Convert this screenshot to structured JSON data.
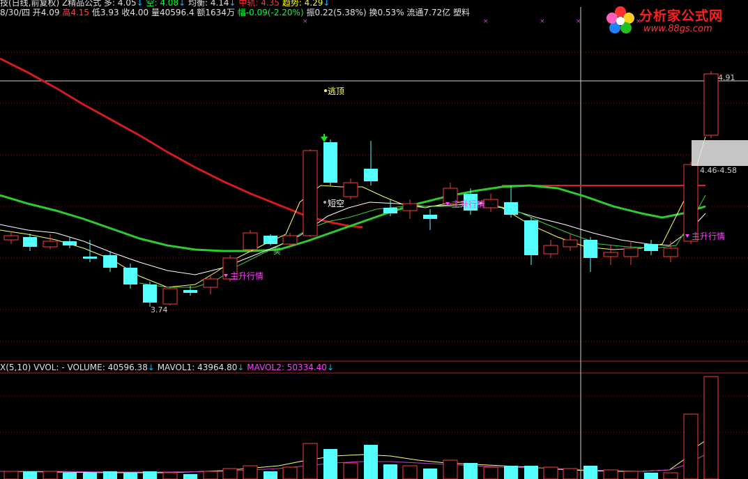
{
  "top_bar": {
    "segments": [
      {
        "text": "技(日线,前复权) Z精品公式  多: 4.05",
        "color": "#e0e0e0"
      },
      {
        "text": "↓",
        "color": "#00c0ff"
      },
      {
        "text": "  空: 4.08",
        "color": "#00ff40"
      },
      {
        "text": "↓",
        "color": "#00c0ff"
      },
      {
        "text": "  均衡: 4.14",
        "color": "#e0e0e0"
      },
      {
        "text": "↓",
        "color": "#00c0ff"
      },
      {
        "text": "          中轨: 4.35 ",
        "color": "#ff3030"
      },
      {
        "text": "趋势: 4.29",
        "color": "#ffff00"
      },
      {
        "text": "↓",
        "color": "#00c0ff"
      }
    ]
  },
  "second_bar": {
    "segments": [
      {
        "text": "8/30/四 开4.09 ",
        "color": "#e0e0e0"
      },
      {
        "text": "高4.15",
        "color": "#ff4040"
      },
      {
        "text": " 低3.93 收4.00 ",
        "color": "#e0e0e0"
      },
      {
        "text": "量40596.4 额1634万 ",
        "color": "#e0e0e0"
      },
      {
        "text": "幅-0.09(-2.20%)",
        "color": "#00ff40"
      },
      {
        "text": " 振0.22(5.38%) 换0.53% 流通7.72亿 塑料",
        "color": "#e0e0e0"
      }
    ]
  },
  "watermark": {
    "title": "分析家公式网",
    "url": "www.88gs.com"
  },
  "annotations": {
    "escape_top": "逃顶",
    "short_term": "短空",
    "main_rise_1": "主升行情",
    "main_rise_2": "主升行情",
    "main_rise_3": "主升行情",
    "buy": "买"
  },
  "price_labels": {
    "high": "4.91",
    "range": "4.46-4.58",
    "low": "3.74"
  },
  "volume_bar": {
    "segments": [
      {
        "text": "X(5,10)  VVOL: -   VOLUME: 40596.38",
        "color": "#e0e0e0"
      },
      {
        "text": "↓",
        "color": "#00c0ff"
      },
      {
        "text": "   MAVOL1: 43964.80",
        "color": "#e0e0e0"
      },
      {
        "text": "↓",
        "color": "#00c0ff"
      },
      {
        "text": "   MAVOL2: 50334.40",
        "color": "#ff40ff"
      },
      {
        "text": "↓",
        "color": "#00c0ff"
      }
    ]
  },
  "colors": {
    "up": "#ff3b3b",
    "down": "#54ffff",
    "ma_white": "#ffffff",
    "ma_yellow": "#ffff60",
    "ma_green": "#2ccc2c",
    "ma_red": "#d01c1c",
    "vol_ma2": "#c040c0"
  }
}
